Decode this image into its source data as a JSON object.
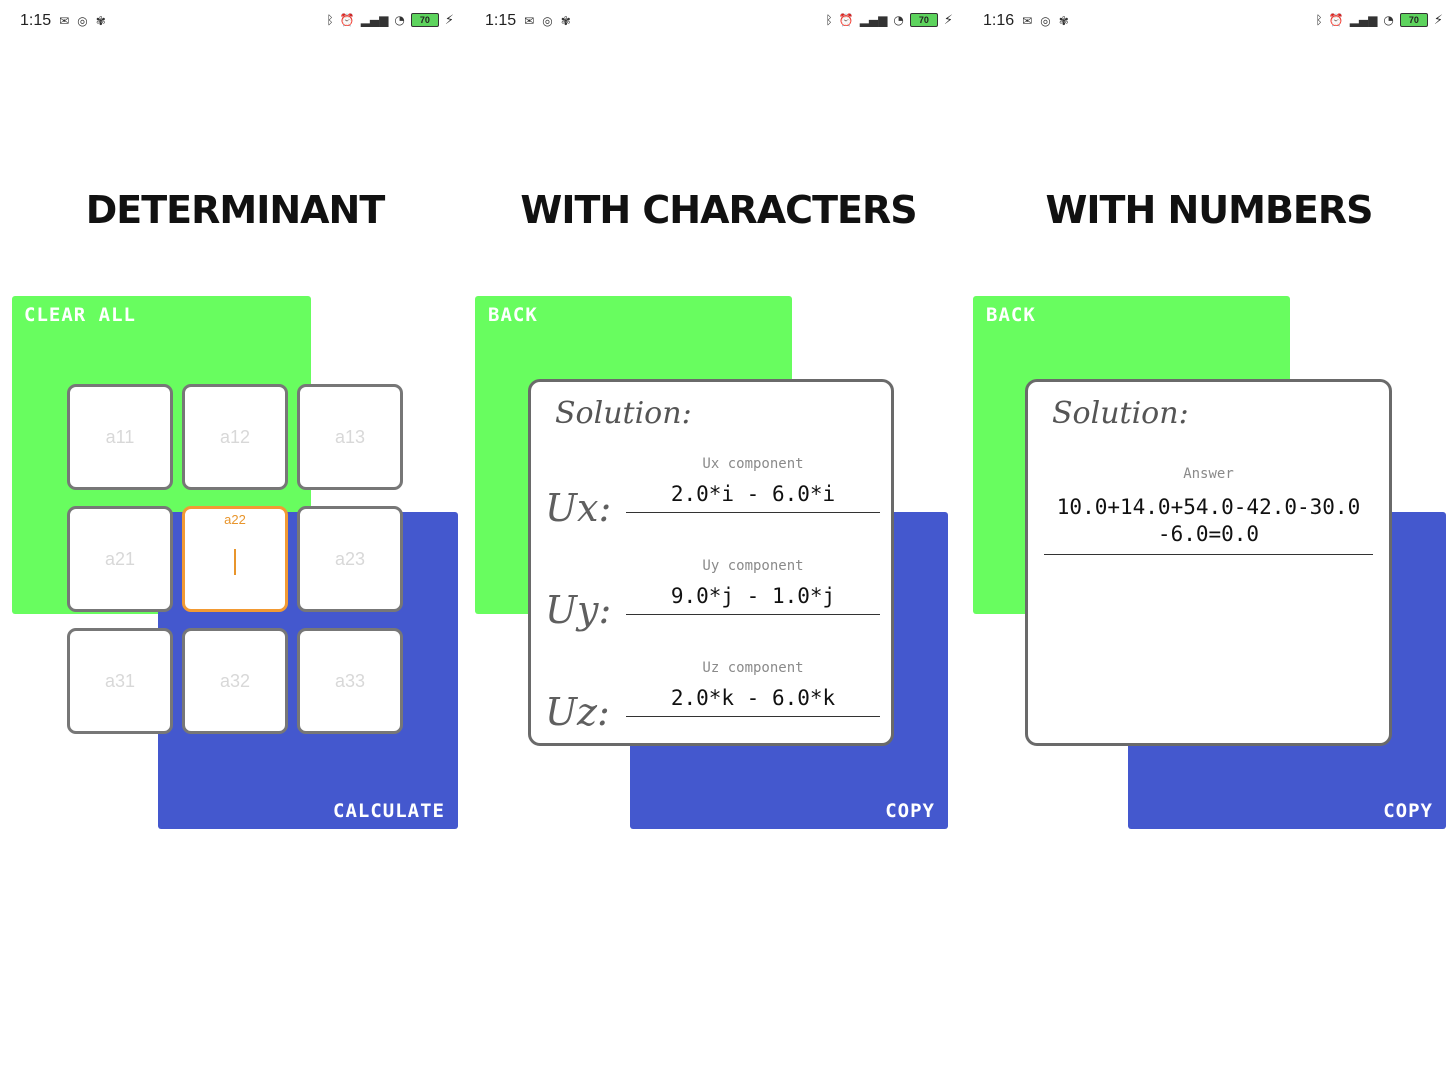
{
  "panels": [
    {
      "status": {
        "time": "1:15",
        "battery": "70"
      },
      "heading": "DETERMINANT",
      "clear_label": "CLEAR ALL",
      "calculate_label": "CALCULATE",
      "cells": {
        "a11": "a11",
        "a12": "a12",
        "a13": "a13",
        "a21": "a21",
        "a22_label": "a22",
        "a23": "a23",
        "a31": "a31",
        "a32": "a32",
        "a33": "a33"
      }
    },
    {
      "status": {
        "time": "1:15",
        "battery": "70"
      },
      "heading": "WITH CHARACTERS",
      "back_label": "BACK",
      "copy_label": "COPY",
      "solution_title": "Solution:",
      "components": [
        {
          "name": "Ux:",
          "hint": "Ux component",
          "value": "2.0*i - 6.0*i"
        },
        {
          "name": "Uy:",
          "hint": "Uy component",
          "value": "9.0*j - 1.0*j"
        },
        {
          "name": "Uz:",
          "hint": "Uz component",
          "value": "2.0*k - 6.0*k"
        }
      ]
    },
    {
      "status": {
        "time": "1:16",
        "battery": "70"
      },
      "heading": "WITH NUMBERS",
      "back_label": "BACK",
      "copy_label": "COPY",
      "solution_title": "Solution:",
      "answer_hint": "Answer",
      "answer_value": "10.0+14.0+54.0-42.0-30.0\n-6.0=0.0"
    }
  ],
  "colors": {
    "green": "#68fd5f",
    "blue": "#4458ce",
    "focus_orange": "#e8952c"
  },
  "icons": [
    "gmail-icon",
    "sync-icon",
    "app-icon",
    "bluetooth-icon",
    "alarm-icon",
    "volte-icon",
    "signal-icon",
    "wifi-icon",
    "battery-icon",
    "charging-icon"
  ]
}
